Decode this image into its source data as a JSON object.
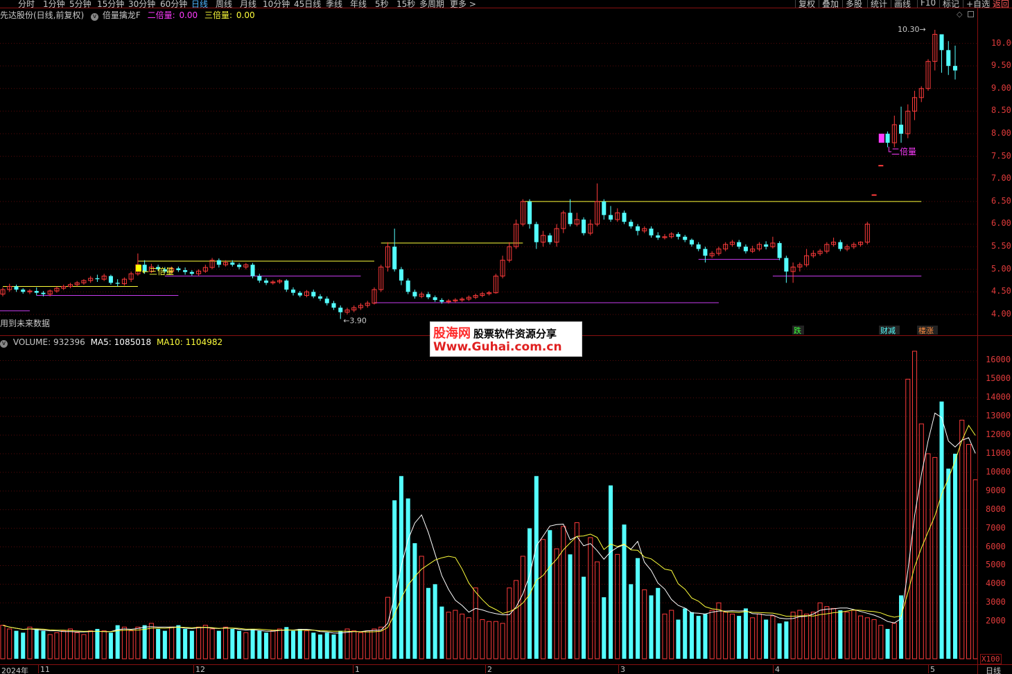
{
  "toolbar": {
    "periods": [
      "分时",
      "1分钟",
      "5分钟",
      "15分钟",
      "30分钟",
      "60分钟",
      "日线",
      "周线",
      "月线",
      "10分钟",
      "45日线",
      "季线",
      "年线",
      "5秒",
      "15秒",
      "多周期",
      "更多 >"
    ],
    "active_period": "日线",
    "right_buttons": [
      "复权",
      "叠加",
      "多股",
      "统计",
      "画线",
      "F10",
      "标记",
      "+自选",
      "返回"
    ]
  },
  "title_row": {
    "stock": "先达股份(日线,前复权)",
    "indicator_name": "倍量擒龙F",
    "two_times_label": "二倍量:",
    "two_times_value": "0.00",
    "three_times_label": "三倍量:",
    "three_times_value": "0.00"
  },
  "price_pane": {
    "y_axis_ticks": [
      "10.00",
      "9.50",
      "9.00",
      "8.50",
      "8.00",
      "7.50",
      "7.00",
      "6.50",
      "6.00",
      "5.50",
      "5.00",
      "4.50",
      "4.00"
    ],
    "high_marker": "10.30",
    "low_marker": "3.90",
    "future_note": "用到未来数据",
    "three_times_tag": "三倍量",
    "two_times_tag": "二倍量",
    "event_tags": [
      "跌",
      "财减",
      "楼涨"
    ]
  },
  "volume_pane": {
    "title": "VOLUME:",
    "volume": "932396",
    "ma5_label": "MA5:",
    "ma5": "1085018",
    "ma10_label": "MA10:",
    "ma10": "1104982",
    "y_axis_ticks": [
      "16000",
      "15000",
      "14000",
      "13000",
      "12000",
      "11000",
      "10000",
      "9000",
      "8000",
      "7000",
      "6000",
      "5000",
      "4000",
      "3000",
      "2000"
    ],
    "unit": "X100"
  },
  "x_axis": {
    "labels": [
      "2024年",
      "11",
      "12",
      "1",
      "2",
      "3",
      "4",
      "5"
    ],
    "period_label": "日线"
  },
  "watermark": {
    "brand": "股海网",
    "subtitle": "股票软件资源分享",
    "url": "Www.Guhai.com.cn"
  },
  "colors": {
    "up": "#ff3b3b",
    "down": "#54ffff",
    "ma5": "#ffffff",
    "ma10": "#ffff3b",
    "support_line": "#c83cf0",
    "resistance_line": "#ffff3b"
  },
  "chart_data": {
    "type": "candlestick",
    "price_ylim": [
      3.8,
      10.3
    ],
    "volume_ylim": [
      0,
      16500
    ],
    "candles": [
      [
        4.45,
        4.55,
        4.6,
        4.4
      ],
      [
        4.55,
        4.62,
        4.68,
        4.5
      ],
      [
        4.62,
        4.55,
        4.66,
        4.5
      ],
      [
        4.55,
        4.5,
        4.58,
        4.46
      ],
      [
        4.5,
        4.52,
        4.56,
        4.45
      ],
      [
        4.52,
        4.48,
        4.6,
        4.42
      ],
      [
        4.48,
        4.45,
        4.52,
        4.4
      ],
      [
        4.45,
        4.52,
        4.55,
        4.4
      ],
      [
        4.52,
        4.58,
        4.62,
        4.48
      ],
      [
        4.58,
        4.62,
        4.66,
        4.54
      ],
      [
        4.62,
        4.66,
        4.7,
        4.58
      ],
      [
        4.66,
        4.7,
        4.74,
        4.62
      ],
      [
        4.7,
        4.75,
        4.78,
        4.66
      ],
      [
        4.75,
        4.8,
        4.85,
        4.7
      ],
      [
        4.8,
        4.78,
        4.88,
        4.72
      ],
      [
        4.78,
        4.85,
        4.9,
        4.74
      ],
      [
        4.85,
        4.7,
        4.88,
        4.66
      ],
      [
        4.7,
        4.68,
        4.78,
        4.62
      ],
      [
        4.68,
        4.78,
        4.82,
        4.64
      ],
      [
        4.78,
        4.9,
        4.95,
        4.72
      ],
      [
        4.9,
        5.1,
        5.35,
        4.86
      ],
      [
        5.1,
        4.95,
        5.2,
        4.9
      ],
      [
        4.95,
        5.05,
        5.12,
        4.92
      ],
      [
        5.05,
        5.0,
        5.1,
        4.96
      ],
      [
        5.0,
        4.95,
        5.05,
        4.92
      ],
      [
        4.95,
        5.02,
        5.06,
        4.9
      ],
      [
        5.02,
        4.98,
        5.06,
        4.94
      ],
      [
        4.98,
        4.94,
        5.04,
        4.88
      ],
      [
        4.94,
        4.9,
        4.98,
        4.86
      ],
      [
        4.9,
        4.96,
        5.0,
        4.86
      ],
      [
        4.96,
        5.04,
        5.1,
        4.92
      ],
      [
        5.04,
        5.2,
        5.25,
        5.0
      ],
      [
        5.2,
        5.1,
        5.24,
        5.04
      ],
      [
        5.1,
        5.15,
        5.2,
        5.06
      ],
      [
        5.15,
        5.1,
        5.2,
        5.06
      ],
      [
        5.1,
        5.05,
        5.14,
        5.0
      ],
      [
        5.05,
        5.1,
        5.14,
        5.0
      ],
      [
        5.1,
        4.85,
        5.14,
        4.8
      ],
      [
        4.85,
        4.75,
        4.9,
        4.7
      ],
      [
        4.75,
        4.7,
        4.8,
        4.65
      ],
      [
        4.7,
        4.72,
        4.76,
        4.66
      ],
      [
        4.72,
        4.75,
        4.78,
        4.68
      ],
      [
        4.75,
        4.55,
        4.78,
        4.5
      ],
      [
        4.55,
        4.48,
        4.6,
        4.42
      ],
      [
        4.48,
        4.42,
        4.52,
        4.38
      ],
      [
        4.42,
        4.5,
        4.54,
        4.38
      ],
      [
        4.5,
        4.4,
        4.55,
        4.36
      ],
      [
        4.4,
        4.35,
        4.45,
        4.3
      ],
      [
        4.35,
        4.25,
        4.4,
        4.2
      ],
      [
        4.25,
        4.15,
        4.3,
        4.1
      ],
      [
        4.15,
        4.05,
        4.2,
        3.9
      ],
      [
        4.05,
        4.1,
        4.15,
        4.0
      ],
      [
        4.1,
        4.15,
        4.2,
        4.05
      ],
      [
        4.15,
        4.2,
        4.25,
        4.1
      ],
      [
        4.2,
        4.25,
        4.3,
        4.15
      ],
      [
        4.25,
        4.55,
        4.6,
        4.22
      ],
      [
        4.55,
        5.05,
        5.1,
        4.5
      ],
      [
        5.05,
        5.5,
        5.6,
        4.95
      ],
      [
        5.5,
        5.0,
        5.9,
        4.95
      ],
      [
        5.0,
        4.75,
        5.05,
        4.65
      ],
      [
        4.75,
        4.5,
        4.8,
        4.45
      ],
      [
        4.5,
        4.4,
        4.55,
        4.35
      ],
      [
        4.4,
        4.45,
        4.5,
        4.36
      ],
      [
        4.45,
        4.38,
        4.5,
        4.34
      ],
      [
        4.38,
        4.32,
        4.42,
        4.28
      ],
      [
        4.32,
        4.28,
        4.36,
        4.24
      ],
      [
        4.28,
        4.3,
        4.34,
        4.24
      ],
      [
        4.3,
        4.32,
        4.36,
        4.26
      ],
      [
        4.32,
        4.34,
        4.38,
        4.28
      ],
      [
        4.34,
        4.38,
        4.42,
        4.3
      ],
      [
        4.38,
        4.42,
        4.46,
        4.34
      ],
      [
        4.42,
        4.46,
        4.5,
        4.38
      ],
      [
        4.46,
        4.48,
        4.52,
        4.42
      ],
      [
        4.48,
        4.85,
        4.9,
        4.46
      ],
      [
        4.85,
        5.2,
        5.3,
        4.8
      ],
      [
        5.2,
        5.5,
        5.6,
        5.15
      ],
      [
        5.5,
        6.0,
        6.1,
        5.45
      ],
      [
        6.0,
        6.5,
        6.55,
        5.95
      ],
      [
        6.5,
        6.0,
        6.55,
        5.9
      ],
      [
        6.0,
        5.6,
        6.05,
        5.45
      ],
      [
        5.6,
        5.75,
        5.85,
        5.5
      ],
      [
        5.75,
        5.6,
        5.8,
        5.55
      ],
      [
        5.6,
        5.9,
        6.0,
        5.5
      ],
      [
        5.9,
        6.25,
        6.3,
        5.8
      ],
      [
        6.25,
        6.0,
        6.55,
        5.95
      ],
      [
        6.0,
        6.1,
        6.25,
        5.95
      ],
      [
        6.1,
        5.8,
        6.15,
        5.75
      ],
      [
        5.8,
        6.0,
        6.1,
        5.75
      ],
      [
        6.0,
        6.5,
        6.9,
        5.95
      ],
      [
        6.5,
        6.2,
        6.55,
        6.1
      ],
      [
        6.2,
        6.1,
        6.4,
        6.05
      ],
      [
        6.1,
        6.25,
        6.35,
        6.05
      ],
      [
        6.25,
        6.05,
        6.3,
        6.0
      ],
      [
        6.05,
        5.95,
        6.1,
        5.9
      ],
      [
        5.95,
        5.85,
        6.0,
        5.75
      ],
      [
        5.85,
        5.9,
        5.95,
        5.8
      ],
      [
        5.9,
        5.75,
        5.95,
        5.7
      ],
      [
        5.75,
        5.7,
        5.82,
        5.65
      ],
      [
        5.7,
        5.72,
        5.78,
        5.66
      ],
      [
        5.72,
        5.78,
        5.82,
        5.68
      ],
      [
        5.78,
        5.72,
        5.82,
        5.66
      ],
      [
        5.72,
        5.65,
        5.76,
        5.6
      ],
      [
        5.65,
        5.55,
        5.68,
        5.5
      ],
      [
        5.55,
        5.45,
        5.6,
        5.4
      ],
      [
        5.45,
        5.3,
        5.5,
        5.15
      ],
      [
        5.3,
        5.35,
        5.4,
        5.25
      ],
      [
        5.35,
        5.45,
        5.5,
        5.3
      ],
      [
        5.45,
        5.55,
        5.6,
        5.4
      ],
      [
        5.55,
        5.6,
        5.65,
        5.5
      ],
      [
        5.6,
        5.5,
        5.65,
        5.45
      ],
      [
        5.5,
        5.4,
        5.55,
        5.35
      ],
      [
        5.4,
        5.45,
        5.52,
        5.36
      ],
      [
        5.45,
        5.55,
        5.6,
        5.4
      ],
      [
        5.55,
        5.5,
        5.62,
        5.44
      ],
      [
        5.5,
        5.58,
        5.72,
        5.46
      ],
      [
        5.58,
        5.25,
        5.62,
        5.2
      ],
      [
        5.25,
        4.95,
        5.3,
        4.7
      ],
      [
        4.95,
        5.05,
        5.15,
        4.7
      ],
      [
        5.05,
        5.1,
        5.15,
        4.95
      ],
      [
        5.1,
        5.3,
        5.45,
        5.05
      ],
      [
        5.3,
        5.35,
        5.42,
        5.25
      ],
      [
        5.35,
        5.4,
        5.45,
        5.3
      ],
      [
        5.4,
        5.55,
        5.6,
        5.35
      ],
      [
        5.55,
        5.6,
        5.7,
        5.5
      ],
      [
        5.6,
        5.45,
        5.65,
        5.4
      ],
      [
        5.45,
        5.5,
        5.55,
        5.4
      ],
      [
        5.5,
        5.55,
        5.6,
        5.45
      ],
      [
        5.55,
        5.6,
        5.62,
        5.5
      ],
      [
        5.6,
        6.0,
        6.05,
        5.55
      ],
      [
        6.65,
        6.65,
        6.66,
        6.64
      ],
      [
        7.3,
        7.3,
        7.31,
        7.29
      ],
      [
        8.0,
        7.8,
        8.05,
        7.7
      ],
      [
        7.8,
        8.2,
        8.4,
        7.7
      ],
      [
        8.2,
        8.0,
        8.6,
        7.8
      ],
      [
        8.0,
        8.5,
        8.65,
        7.9
      ],
      [
        8.5,
        8.8,
        8.95,
        8.3
      ],
      [
        8.8,
        9.0,
        9.05,
        8.7
      ],
      [
        9.0,
        9.6,
        9.65,
        8.95
      ],
      [
        9.6,
        10.2,
        10.3,
        9.4
      ],
      [
        10.2,
        9.85,
        10.15,
        9.35
      ],
      [
        9.85,
        9.5,
        10.05,
        9.3
      ],
      [
        9.5,
        9.4,
        9.95,
        9.2
      ]
    ],
    "volumes": [
      1800,
      1600,
      1500,
      1400,
      1700,
      1600,
      1500,
      1300,
      1400,
      1500,
      1600,
      1400,
      1300,
      1500,
      1600,
      1500,
      1400,
      1800,
      1700,
      1500,
      1700,
      1800,
      1900,
      1600,
      1500,
      1700,
      1800,
      1600,
      1500,
      1700,
      1800,
      1600,
      1500,
      1700,
      1600,
      1500,
      1400,
      1600,
      1500,
      1400,
      1500,
      1600,
      1700,
      1500,
      1600,
      1500,
      1400,
      1300,
      1400,
      1300,
      1500,
      1600,
      1500,
      1400,
      1500,
      1600,
      1700,
      3300,
      8500,
      9800,
      8600,
      6200,
      5500,
      3800,
      4000,
      2800,
      2500,
      2600,
      2400,
      2200,
      3800,
      2100,
      2000,
      2000,
      1900,
      3800,
      4200,
      5500,
      7000,
      9800,
      6400,
      6900,
      5900,
      7100,
      5600,
      7300,
      4400,
      6500,
      5200,
      3300,
      9300,
      5600,
      7200,
      4000,
      5400,
      3700,
      3400,
      3800,
      2400,
      2600,
      2100,
      2700,
      2500,
      2300,
      2400,
      2600,
      3000,
      2500,
      2400,
      2300,
      2700,
      2200,
      2400,
      2100,
      2300,
      1900,
      2000,
      2500,
      2600,
      2400,
      2500,
      3000,
      2800,
      2700,
      2600,
      2500,
      2600,
      2300,
      2200,
      2100,
      1800,
      1600,
      1900,
      3400,
      15000,
      16500,
      12600,
      11000,
      10800,
      13800,
      10200,
      11000,
      12800,
      11500,
      9600
    ]
  }
}
